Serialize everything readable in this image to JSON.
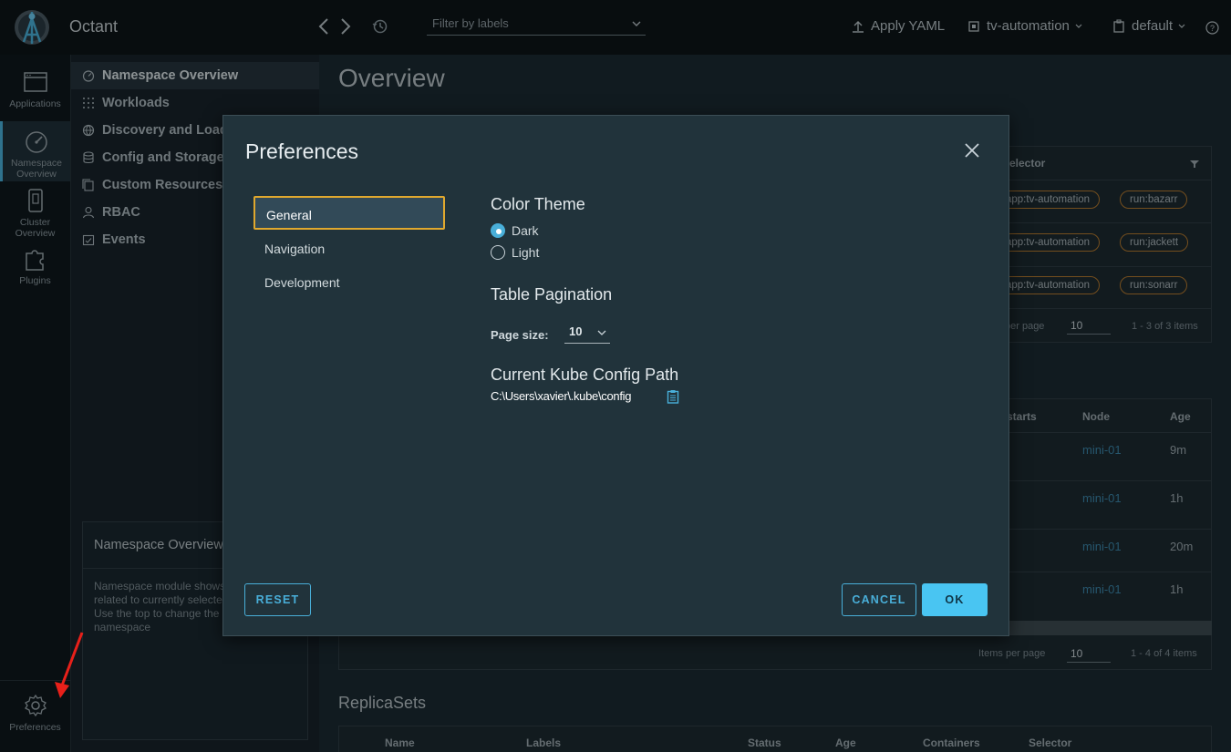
{
  "header": {
    "app_title": "Octant",
    "filter_placeholder": "Filter by labels",
    "apply_yaml": "Apply YAML",
    "context": "tv-automation",
    "namespace": "default"
  },
  "rail": {
    "items": [
      {
        "label": "Applications"
      },
      {
        "label": "Namespace Overview"
      },
      {
        "label": "Cluster Overview"
      },
      {
        "label": "Plugins"
      }
    ],
    "preferences_label": "Preferences"
  },
  "subnav": {
    "items": [
      {
        "label": "Namespace Overview"
      },
      {
        "label": "Workloads"
      },
      {
        "label": "Discovery and Load Balancing"
      },
      {
        "label": "Config and Storage"
      },
      {
        "label": "Custom Resources"
      },
      {
        "label": "RBAC"
      },
      {
        "label": "Events"
      }
    ],
    "help_title": "Namespace Overview",
    "help_body": "Namespace module shows all resources related to currently selected namespace Use the top to change the selected namespace"
  },
  "main": {
    "title": "Overview",
    "selector_header": "Selector",
    "deployments": [
      {
        "app": "app:tv-automation",
        "run": "run:bazarr"
      },
      {
        "app": "app:tv-automation",
        "run": "run:jackett"
      },
      {
        "app": "app:tv-automation",
        "run": "run:sonarr"
      }
    ],
    "per_page_label_1": "per page",
    "per_page_value_1": "10",
    "range_1": "1 - 3 of 3 items",
    "pods_headers": {
      "restarts": "starts",
      "node": "Node",
      "age": "Age"
    },
    "pods": [
      {
        "node": "mini-01",
        "age": "9m"
      },
      {
        "node": "mini-01",
        "age": "1h"
      },
      {
        "node": "mini-01",
        "age": "20m"
      },
      {
        "node": "mini-01",
        "age": "1h"
      }
    ],
    "per_page_label_2": "Items per page",
    "per_page_value_2": "10",
    "range_2": "1 - 4 of 4 items",
    "replicasets_title": "ReplicaSets",
    "rs_headers": [
      "Name",
      "Labels",
      "Status",
      "Age",
      "Containers",
      "Selector"
    ]
  },
  "modal": {
    "title": "Preferences",
    "tabs": [
      {
        "label": "General"
      },
      {
        "label": "Navigation"
      },
      {
        "label": "Development"
      }
    ],
    "color_theme_title": "Color Theme",
    "theme_options": [
      {
        "label": "Dark",
        "selected": true
      },
      {
        "label": "Light",
        "selected": false
      }
    ],
    "pagination_title": "Table Pagination",
    "page_size_label": "Page size:",
    "page_size_value": "10",
    "kube_title": "Current Kube Config Path",
    "kube_path": "C:\\Users\\xavier\\.kube\\config",
    "reset_label": "RESET",
    "cancel_label": "CANCEL",
    "ok_label": "OK"
  },
  "colors": {
    "accent": "#49afd9",
    "primary_button": "#49c5f2",
    "active_tab_border": "#e0a82e",
    "label_pill_border": "#b2782e"
  }
}
